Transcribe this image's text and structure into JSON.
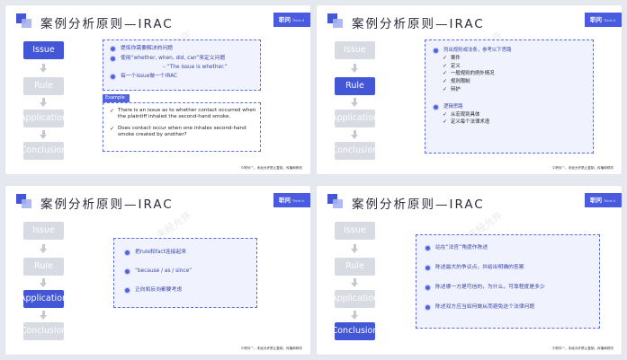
{
  "title": "案例分析原则—IRAC",
  "brand": {
    "name": "职问",
    "sub": "Think it first"
  },
  "footer": "©职问™。未经允许禁止复制、传播和修改",
  "watermark": [
    "©职问™ 未经允许",
    "传播和修改"
  ],
  "steps": [
    "Issue",
    "Rule",
    "Application",
    "Conclusion"
  ],
  "slide1": {
    "bullets": [
      "提炼你需要解决的问题",
      "使用“whether, when, did, can”来定义问题",
      "每一个issue做一个IRAC"
    ],
    "continuation": "– “The issue is whether.”",
    "example_label": "Example",
    "examples": [
      "There is an issue as to whether contact occurred when the plaintiff inhaled the second-hand smoke.",
      "Does contact occur when one inhales second-hand smoke created by another?"
    ]
  },
  "slide2": {
    "heading1": "列出规则或法条，参考以下思路",
    "items1": [
      "案件",
      "定义",
      "一般规则的例外情况",
      "规则限制",
      "辩护"
    ],
    "heading2": "逻辑思路",
    "items2": [
      "从宏观到具体",
      "定义每个法律术语"
    ]
  },
  "slide3": {
    "bullets": [
      "把rule和fact连接起来",
      "“because / as / since”",
      "正向和反向都要考虑"
    ]
  },
  "slide4": {
    "bullets": [
      "站在“法官”角度作陈述",
      "陈述最大的争议点，并给出明确的答案",
      "陈述哪一方是可信的，为什么，可靠程度是多少",
      "陈述双方应当如何做从而避免这个法律问题"
    ]
  }
}
